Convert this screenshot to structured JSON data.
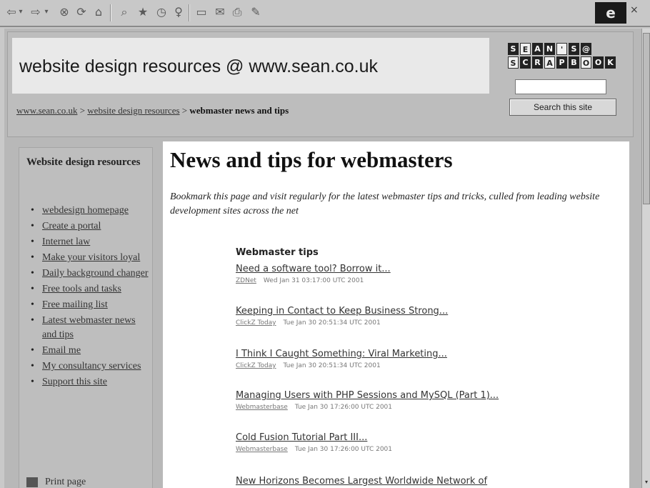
{
  "toolbar": {
    "back_icon": "⇦",
    "dropdown_icon": "▾",
    "forward_icon": "⇨",
    "stop_icon": "⊗",
    "refresh_icon": "⟳",
    "home_icon": "⌂",
    "search_icon": "⌕",
    "favorites_icon": "★",
    "history_icon": "◷",
    "channels_icon": "♀",
    "fullscreen_icon": "▭",
    "mail_icon": "✉",
    "print_icon": "⎙",
    "edit_icon": "✎",
    "brand_icon": "e",
    "close_icon": "×"
  },
  "header": {
    "site_title": "website design resources @ www.sean.co.uk",
    "logo_row1": [
      "S",
      "E",
      "A",
      "N",
      "'",
      "S",
      "@"
    ],
    "logo_row2": [
      "S",
      "C",
      "R",
      "A",
      "P",
      "B",
      "O",
      "O",
      "K"
    ],
    "breadcrumb": {
      "link1": "www.sean.co.uk",
      "sep1": " > ",
      "link2": "website design resources",
      "sep2": " > ",
      "current": "webmaster news and tips"
    },
    "search_value": "",
    "search_button": "Search this site"
  },
  "sidebar": {
    "title": "Website design resources",
    "items": [
      {
        "label": "webdesign homepage"
      },
      {
        "label": "Create a portal"
      },
      {
        "label": "Internet law"
      },
      {
        "label": "Make your visitors loyal"
      },
      {
        "label": "Daily background changer"
      },
      {
        "label": "Free tools and tasks"
      },
      {
        "label": "Free mailing list"
      },
      {
        "label": "Latest webmaster news and tips"
      },
      {
        "label": "Email me"
      },
      {
        "label": "My consultancy services"
      },
      {
        "label": "Support this site"
      }
    ],
    "print_label": "Print page"
  },
  "main": {
    "heading": "News and tips for webmasters",
    "intro": "Bookmark this page and visit regularly for the latest webmaster tips and tricks, culled from leading website development sites across the net",
    "tips_header": "Webmaster tips",
    "tips": [
      {
        "title": "Need a software tool? Borrow it...",
        "source": "ZDNet",
        "date": "Wed Jan 31 03:17:00 UTC 2001"
      },
      {
        "title": "Keeping in Contact to Keep Business Strong...",
        "source": "ClickZ Today",
        "date": "Tue Jan 30 20:51:34 UTC 2001"
      },
      {
        "title": "I Think I Caught Something: Viral Marketing...",
        "source": "ClickZ Today",
        "date": "Tue Jan 30 20:51:34 UTC 2001"
      },
      {
        "title": "Managing Users with PHP Sessions and MySQL (Part 1)...",
        "source": "Webmasterbase",
        "date": "Tue Jan 30 17:26:00 UTC 2001"
      },
      {
        "title": "Cold Fusion Tutorial Part III...",
        "source": "Webmasterbase",
        "date": "Tue Jan 30 17:26:00 UTC 2001"
      },
      {
        "title": "New Horizons Becomes Largest Worldwide Network of",
        "source": "",
        "date": ""
      }
    ]
  }
}
